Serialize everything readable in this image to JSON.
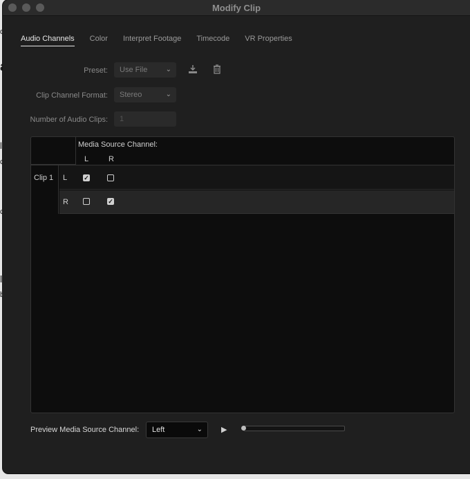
{
  "window": {
    "title": "Modify Clip"
  },
  "tabs": [
    {
      "label": "Audio Channels",
      "active": true
    },
    {
      "label": "Color",
      "active": false
    },
    {
      "label": "Interpret Footage",
      "active": false
    },
    {
      "label": "Timecode",
      "active": false
    },
    {
      "label": "VR Properties",
      "active": false
    }
  ],
  "form": {
    "preset_label": "Preset:",
    "preset_value": "Use File",
    "format_label": "Clip Channel Format:",
    "format_value": "Stereo",
    "num_clips_label": "Number of Audio Clips:",
    "num_clips_value": "1"
  },
  "grid": {
    "header": "Media Source Channel:",
    "columns": [
      "L",
      "R"
    ],
    "clip_label": "Clip 1",
    "rows": [
      {
        "channel": "L",
        "checks": [
          true,
          false
        ]
      },
      {
        "channel": "R",
        "checks": [
          false,
          true
        ]
      }
    ]
  },
  "preview": {
    "label": "Preview Media Source Channel:",
    "selected": "Left",
    "progress": 0
  },
  "background_fragments": [
    "d",
    "a",
    "l",
    "c",
    "c",
    "l",
    "b"
  ],
  "icons": {
    "save_preset": "download-icon",
    "delete_preset": "trash-icon",
    "play": "play-icon",
    "dropdown": "chevron-down-icon"
  }
}
